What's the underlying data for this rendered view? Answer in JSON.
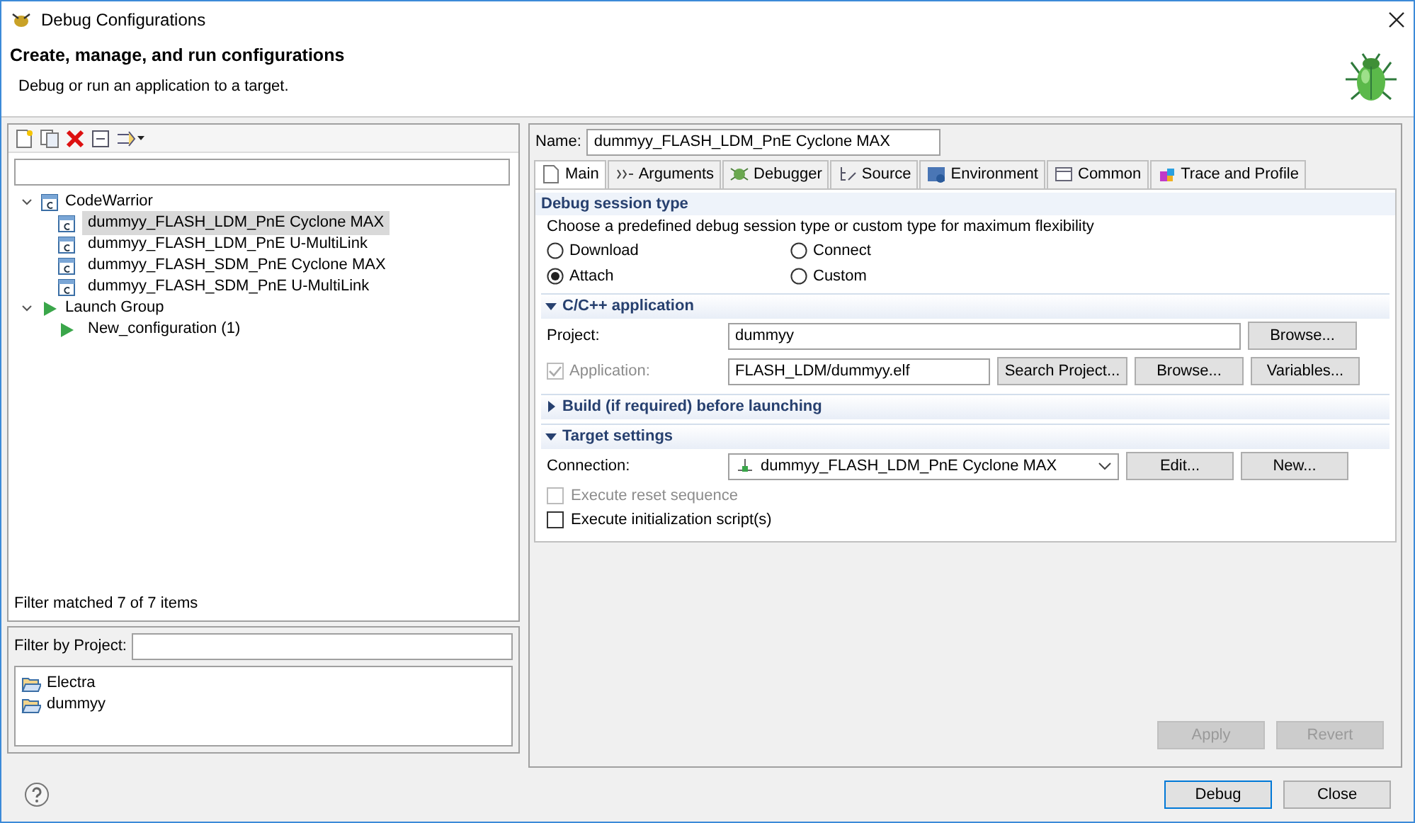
{
  "window": {
    "title": "Debug Configurations"
  },
  "header": {
    "title": "Create, manage, and run configurations",
    "subtitle": "Debug or run an application to a target."
  },
  "tree": [
    {
      "label": "CodeWarrior",
      "kind": "cw",
      "expanded": true,
      "children": [
        {
          "label": "dummyy_FLASH_LDM_PnE Cyclone MAX",
          "selected": true
        },
        {
          "label": "dummyy_FLASH_LDM_PnE U-MultiLink",
          "selected": false
        },
        {
          "label": "dummyy_FLASH_SDM_PnE Cyclone MAX",
          "selected": false
        },
        {
          "label": "dummyy_FLASH_SDM_PnE U-MultiLink",
          "selected": false
        }
      ]
    },
    {
      "label": "Launch Group",
      "kind": "launch",
      "expanded": true,
      "children": [
        {
          "label": "New_configuration (1)",
          "selected": false
        }
      ]
    }
  ],
  "filter_status": "Filter matched 7 of 7 items",
  "project_filter": {
    "label": "Filter by Project:",
    "projects": [
      "Electra",
      "dummyy"
    ]
  },
  "name": {
    "label": "Name:",
    "value": "dummyy_FLASH_LDM_PnE Cyclone MAX"
  },
  "tabs": [
    {
      "label": "Main",
      "selected": true
    },
    {
      "label": "Arguments",
      "selected": false
    },
    {
      "label": "Debugger",
      "selected": false
    },
    {
      "label": "Source",
      "selected": false
    },
    {
      "label": "Environment",
      "selected": false
    },
    {
      "label": "Common",
      "selected": false
    },
    {
      "label": "Trace and Profile",
      "selected": false
    }
  ],
  "session": {
    "heading": "Debug session type",
    "description": "Choose a predefined debug session type or custom type for maximum flexibility",
    "options": [
      {
        "label": "Download",
        "selected": false
      },
      {
        "label": "Connect",
        "selected": false
      },
      {
        "label": "Attach",
        "selected": true
      },
      {
        "label": "Custom",
        "selected": false
      }
    ]
  },
  "sections": [
    {
      "title": "C/C++ application",
      "expanded": true,
      "rows": [
        {
          "kind": "field",
          "label": "Project:",
          "value": "dummyy",
          "buttons": [
            "Browse..."
          ]
        },
        {
          "kind": "checkfield",
          "label": "Application:",
          "checked": true,
          "disabled": true,
          "value": "FLASH_LDM/dummyy.elf",
          "buttons": [
            "Search Project...",
            "Browse...",
            "Variables..."
          ]
        }
      ]
    },
    {
      "title": "Build (if required) before launching",
      "expanded": false
    },
    {
      "title": "Target settings",
      "expanded": true,
      "rows": [
        {
          "kind": "select",
          "label": "Connection:",
          "value": "dummyy_FLASH_LDM_PnE Cyclone MAX",
          "buttons": [
            "Edit...",
            "New..."
          ]
        },
        {
          "kind": "check",
          "label": "Execute reset sequence",
          "checked": false,
          "disabled": true
        },
        {
          "kind": "check",
          "label": "Execute initialization script(s)",
          "checked": false,
          "disabled": false
        }
      ]
    }
  ],
  "panel_buttons": [
    {
      "label": "Apply",
      "disabled": true
    },
    {
      "label": "Revert",
      "disabled": true
    }
  ],
  "dialog_buttons": [
    {
      "label": "Debug",
      "default": true
    },
    {
      "label": "Close",
      "default": false
    }
  ]
}
